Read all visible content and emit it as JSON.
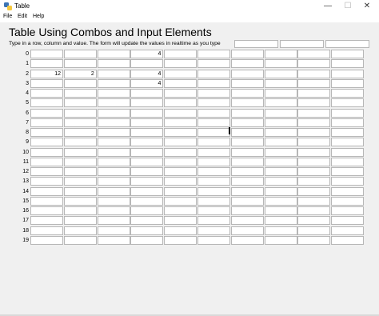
{
  "window": {
    "title": "Table"
  },
  "window_controls": {
    "minimize": "—",
    "maximize": "☐",
    "close": "✕"
  },
  "menu": {
    "items": [
      "File",
      "Edit",
      "Help"
    ]
  },
  "heading": "Table Using Combos and Input Elements",
  "instruction": "Type in a row, column and value. The form will update the values in realtime as you type",
  "inputs": {
    "row": "",
    "column": "",
    "value": ""
  },
  "table": {
    "row_labels": [
      "0",
      "1",
      "2",
      "3",
      "4",
      "5",
      "6",
      "7",
      "8",
      "9",
      "10",
      "11",
      "12",
      "13",
      "14",
      "15",
      "16",
      "17",
      "18",
      "19"
    ],
    "column_count": 10,
    "rows": [
      [
        "",
        "",
        "",
        "4",
        "",
        "",
        "",
        "",
        "",
        ""
      ],
      [
        "",
        "",
        "",
        "",
        "",
        "",
        "",
        "",
        "",
        ""
      ],
      [
        "12",
        "2",
        "",
        "4",
        "",
        "",
        "",
        "",
        "",
        ""
      ],
      [
        "",
        "",
        "",
        "4",
        "",
        "",
        "",
        "",
        "",
        ""
      ],
      [
        "",
        "",
        "",
        "",
        "",
        "",
        "",
        "",
        "",
        ""
      ],
      [
        "",
        "",
        "",
        "",
        "",
        "",
        "",
        "",
        "",
        ""
      ],
      [
        "",
        "",
        "",
        "",
        "",
        "",
        "",
        "",
        "",
        ""
      ],
      [
        "",
        "",
        "",
        "",
        "",
        "",
        "",
        "",
        "",
        ""
      ],
      [
        "",
        "",
        "",
        "",
        "",
        "",
        "",
        "",
        "",
        ""
      ],
      [
        "",
        "",
        "",
        "",
        "",
        "",
        "",
        "",
        "",
        ""
      ],
      [
        "",
        "",
        "",
        "",
        "",
        "",
        "",
        "",
        "",
        ""
      ],
      [
        "",
        "",
        "",
        "",
        "",
        "",
        "",
        "",
        "",
        ""
      ],
      [
        "",
        "",
        "",
        "",
        "",
        "",
        "",
        "",
        "",
        ""
      ],
      [
        "",
        "",
        "",
        "",
        "",
        "",
        "",
        "",
        "",
        ""
      ],
      [
        "",
        "",
        "",
        "",
        "",
        "",
        "",
        "",
        "",
        ""
      ],
      [
        "",
        "",
        "",
        "",
        "",
        "",
        "",
        "",
        "",
        ""
      ],
      [
        "",
        "",
        "",
        "",
        "",
        "",
        "",
        "",
        "",
        ""
      ],
      [
        "",
        "",
        "",
        "",
        "",
        "",
        "",
        "",
        "",
        ""
      ],
      [
        "",
        "",
        "",
        "",
        "",
        "",
        "",
        "",
        "",
        ""
      ],
      [
        "",
        "",
        "",
        "",
        "",
        "",
        "",
        "",
        "",
        ""
      ]
    ]
  }
}
